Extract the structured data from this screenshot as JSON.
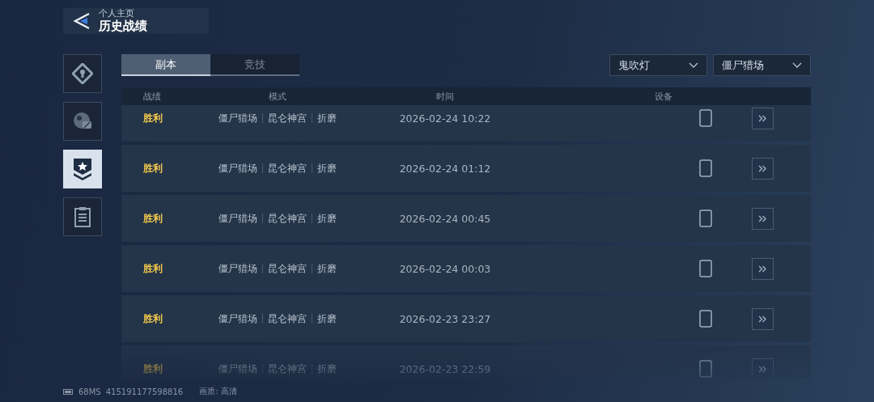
{
  "header": {
    "subtitle": "个人主页",
    "title": "历史战绩"
  },
  "sidebar": {
    "items": [
      {
        "selected": false
      },
      {
        "selected": false
      },
      {
        "selected": true
      },
      {
        "selected": false
      }
    ]
  },
  "tabs": [
    {
      "label": "副本",
      "selected": true
    },
    {
      "label": "竞技",
      "selected": false
    }
  ],
  "filters": [
    {
      "value": "鬼吹灯"
    },
    {
      "value": "僵尸猎场"
    }
  ],
  "table": {
    "columns": [
      "战绩",
      "模式",
      "时间",
      "设备"
    ],
    "rows": [
      {
        "result": "胜利",
        "mode": [
          "僵尸猎场",
          "昆仑神宫",
          "折磨"
        ],
        "time": "2026-02-24 10:22"
      },
      {
        "result": "胜利",
        "mode": [
          "僵尸猎场",
          "昆仑神宫",
          "折磨"
        ],
        "time": "2026-02-24 01:12"
      },
      {
        "result": "胜利",
        "mode": [
          "僵尸猎场",
          "昆仑神宫",
          "折磨"
        ],
        "time": "2026-02-24 00:45"
      },
      {
        "result": "胜利",
        "mode": [
          "僵尸猎场",
          "昆仑神宫",
          "折磨"
        ],
        "time": "2026-02-24 00:03"
      },
      {
        "result": "胜利",
        "mode": [
          "僵尸猎场",
          "昆仑神宫",
          "折磨"
        ],
        "time": "2026-02-23 23:27"
      },
      {
        "result": "胜利",
        "mode": [
          "僵尸猎场",
          "昆仑神宫",
          "折磨"
        ],
        "time": "2026-02-23 22:59"
      }
    ]
  },
  "status_bar": {
    "ping": "68MS",
    "id": "415191177598816",
    "quality": "画质: 高清"
  }
}
